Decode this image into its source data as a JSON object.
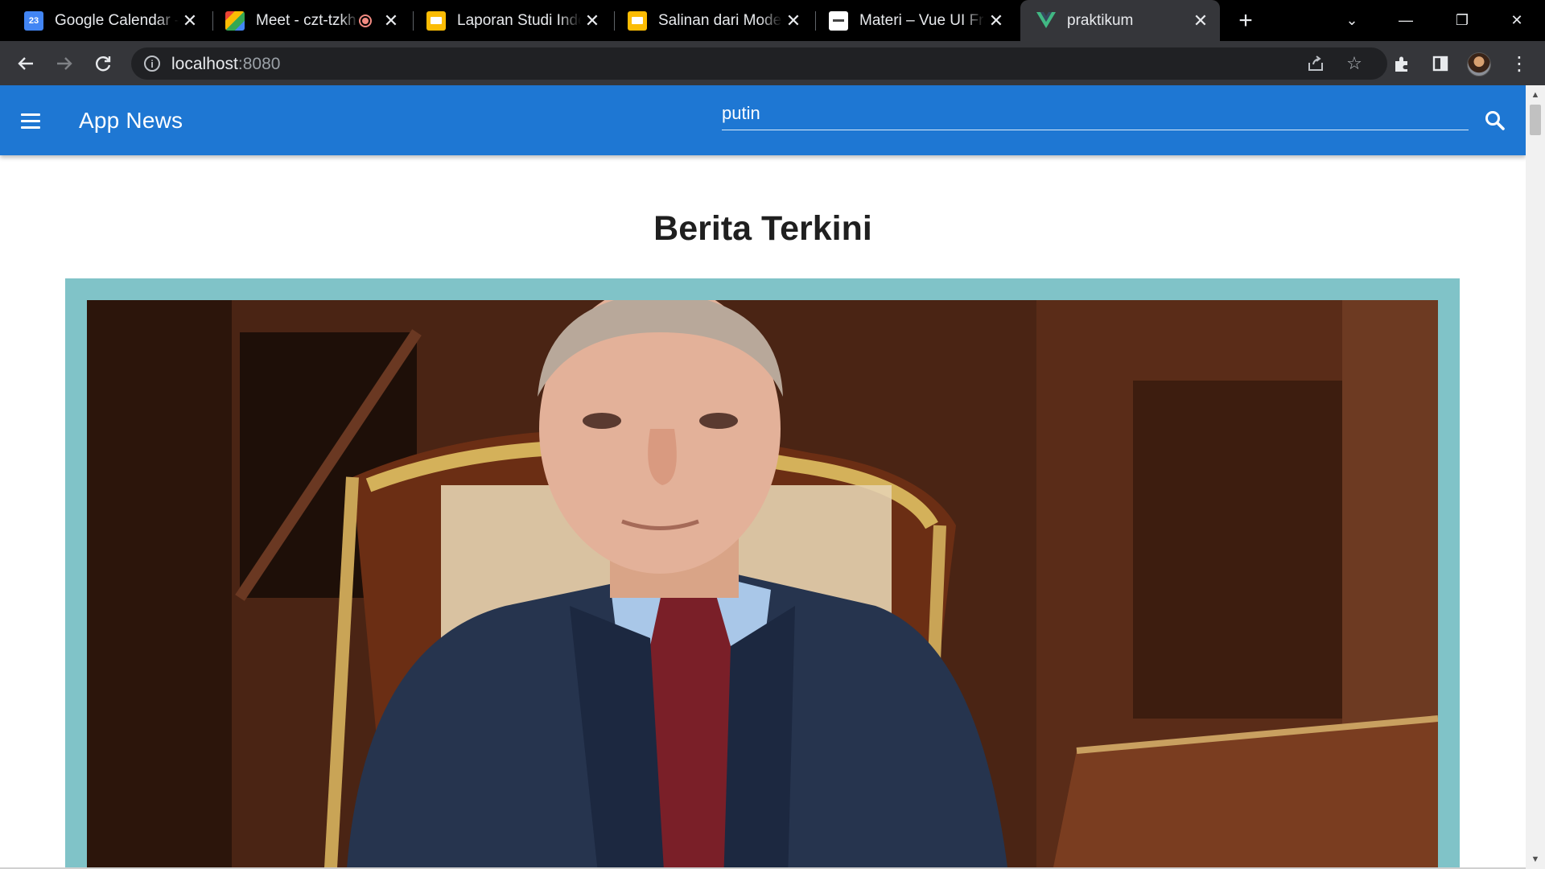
{
  "browser": {
    "tabs": [
      {
        "title": "Google Calendar - W",
        "favicon_text": "23",
        "favicon_color": "#4285f4"
      },
      {
        "title": "Meet - czt-tzkh",
        "favicon_text": "",
        "favicon_color": "#34a853",
        "recording": true
      },
      {
        "title": "Laporan Studi Indep",
        "favicon_text": "",
        "favicon_color": "#fbbc04"
      },
      {
        "title": "Salinan dari Modern",
        "favicon_text": "",
        "favicon_color": "#fbbc04"
      },
      {
        "title": "Materi – Vue UI Fra",
        "favicon_text": "",
        "favicon_color": "#ffffff"
      },
      {
        "title": "praktikum",
        "favicon_text": "",
        "favicon_color": "#41b883",
        "active": true
      }
    ],
    "url_host": "localhost",
    "url_port": ":8080",
    "active_tab_bg": "#35363a"
  },
  "app": {
    "title": "App News",
    "bar_color": "#1e77d3",
    "search_value": "putin"
  },
  "main": {
    "headline": "Berita Terkini",
    "card_border_color": "#80c3c8"
  }
}
